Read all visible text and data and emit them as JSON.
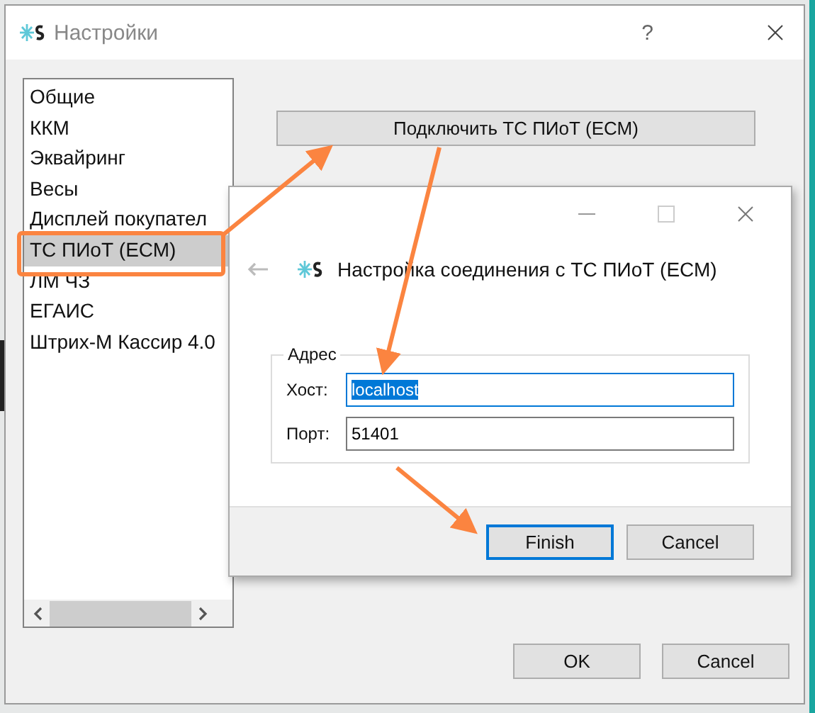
{
  "window": {
    "title": "Настройки",
    "help": "?"
  },
  "sidebar": {
    "items": [
      {
        "label": "Общие",
        "selected": false
      },
      {
        "label": "ККМ",
        "selected": false
      },
      {
        "label": "Эквайринг",
        "selected": false
      },
      {
        "label": "Весы",
        "selected": false
      },
      {
        "label": "Дисплей покупател",
        "selected": false
      },
      {
        "label": "ТС ПИоТ (ЕСМ)",
        "selected": true
      },
      {
        "label": "ЛМ ЧЗ",
        "selected": false
      },
      {
        "label": "ЕГАИС",
        "selected": false
      },
      {
        "label": "Штрих-М Кассир 4.0",
        "selected": false
      }
    ]
  },
  "connect_button": "Подключить ТС ПИоТ (ЕСМ)",
  "dialog": {
    "title": "Настройка соединения с ТС ПИоТ (ЕСМ)",
    "group": "Адрес",
    "fields": [
      {
        "label": "Хост:",
        "value": "localhost",
        "focused": true
      },
      {
        "label": "Порт:",
        "value": "51401",
        "focused": false
      }
    ],
    "buttons": [
      {
        "label": "Finish",
        "default": true
      },
      {
        "label": "Cancel",
        "default": false
      }
    ]
  },
  "buttons": [
    {
      "label": "OK",
      "default": false
    },
    {
      "label": "Cancel",
      "default": false
    }
  ]
}
